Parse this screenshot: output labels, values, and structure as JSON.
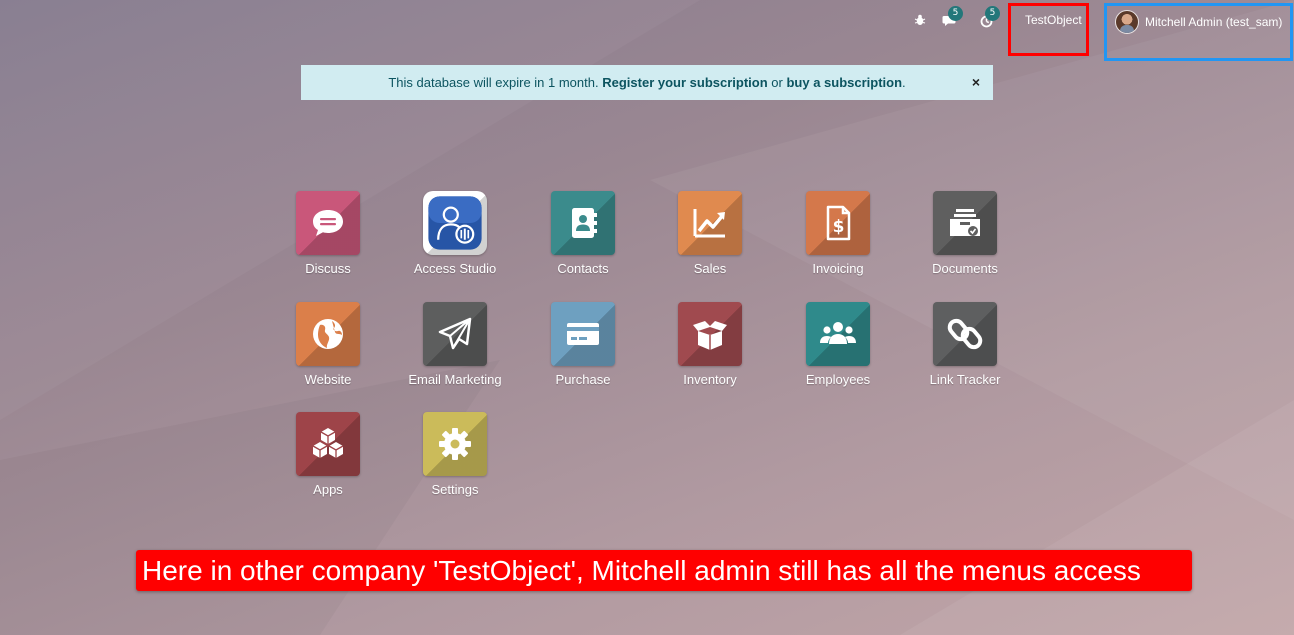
{
  "topbar": {
    "debug_icon": "bug-icon",
    "messages_count": "5",
    "activity_count": "5",
    "company": "TestObject",
    "user_name": "Mitchell Admin (test_sam)"
  },
  "banner": {
    "text_prefix": "This database will expire in 1 month.",
    "register_link": "Register your subscription",
    "or_text": "or",
    "buy_link": "buy a subscription",
    "suffix": ".",
    "close": "×"
  },
  "apps": [
    {
      "label": "Discuss",
      "color": "#c9577a",
      "icon": "chat-bubble-icon"
    },
    {
      "label": "Access Studio",
      "color": "#ffffff",
      "icon": "access-studio-icon"
    },
    {
      "label": "Contacts",
      "color": "#3b8b8c",
      "icon": "address-book-icon"
    },
    {
      "label": "Sales",
      "color": "#e08a4f",
      "icon": "trending-chart-icon"
    },
    {
      "label": "Invoicing",
      "color": "#d4784b",
      "icon": "invoice-dollar-icon"
    },
    {
      "label": "Documents",
      "color": "#5f5f5f",
      "icon": "document-tray-icon"
    },
    {
      "label": "Website",
      "color": "#db7f4a",
      "icon": "globe-icon"
    },
    {
      "label": "Email Marketing",
      "color": "#5d5e5e",
      "icon": "paper-plane-icon"
    },
    {
      "label": "Purchase",
      "color": "#6ea0c0",
      "icon": "credit-card-icon"
    },
    {
      "label": "Inventory",
      "color": "#a04a4f",
      "icon": "open-box-icon"
    },
    {
      "label": "Employees",
      "color": "#2f8a8b",
      "icon": "users-group-icon"
    },
    {
      "label": "Link Tracker",
      "color": "#5e5f60",
      "icon": "chain-link-icon"
    },
    {
      "label": "Apps",
      "color": "#9e4449",
      "icon": "cubes-icon"
    },
    {
      "label": "Settings",
      "color": "#cbbb5a",
      "icon": "gear-icon"
    }
  ],
  "annotation": {
    "text": "Here in other company 'TestObject', Mitchell admin still has all the menus access"
  }
}
